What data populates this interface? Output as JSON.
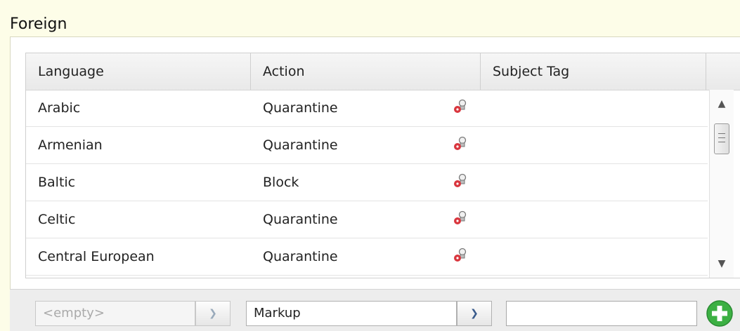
{
  "panel": {
    "title": "Foreign"
  },
  "grid": {
    "headers": {
      "language": "Language",
      "action": "Action",
      "subject_tag": "Subject Tag"
    },
    "rows": [
      {
        "language": "Arabic",
        "action": "Quarantine",
        "subject_tag": ""
      },
      {
        "language": "Armenian",
        "action": "Quarantine",
        "subject_tag": ""
      },
      {
        "language": "Baltic",
        "action": "Block",
        "subject_tag": ""
      },
      {
        "language": "Celtic",
        "action": "Quarantine",
        "subject_tag": ""
      },
      {
        "language": "Central European",
        "action": "Quarantine",
        "subject_tag": ""
      }
    ],
    "row_icon": "edit-pin-icon"
  },
  "toolbar": {
    "language_combo": {
      "value": "<empty>"
    },
    "action_combo": {
      "value": "Markup"
    },
    "subject_input": {
      "value": ""
    },
    "add_icon": "add-circle-icon"
  },
  "colors": {
    "accent_green": "#3cb043",
    "pin_red": "#d9363e"
  }
}
